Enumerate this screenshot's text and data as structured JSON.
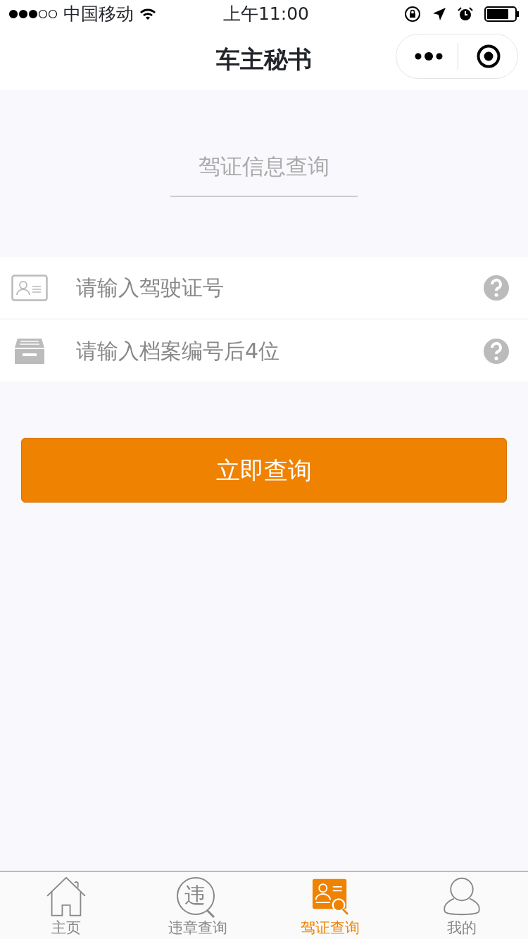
{
  "status_bar": {
    "carrier": "中国移动",
    "time": "上午11:00"
  },
  "nav": {
    "title": "车主秘书"
  },
  "heading": "驾证信息查询",
  "fields": [
    {
      "kind": "license",
      "placeholder": "请输入驾驶证号"
    },
    {
      "kind": "archive",
      "placeholder": "请输入档案编号后4位"
    }
  ],
  "submit": "立即查询",
  "tabs": [
    {
      "kind": "home",
      "label": "主页",
      "selected": false
    },
    {
      "kind": "violation",
      "label": "违章查询",
      "icon_text": "违",
      "selected": false
    },
    {
      "kind": "license",
      "label": "驾证查询",
      "selected": true
    },
    {
      "kind": "me",
      "label": "我的",
      "selected": false
    }
  ]
}
